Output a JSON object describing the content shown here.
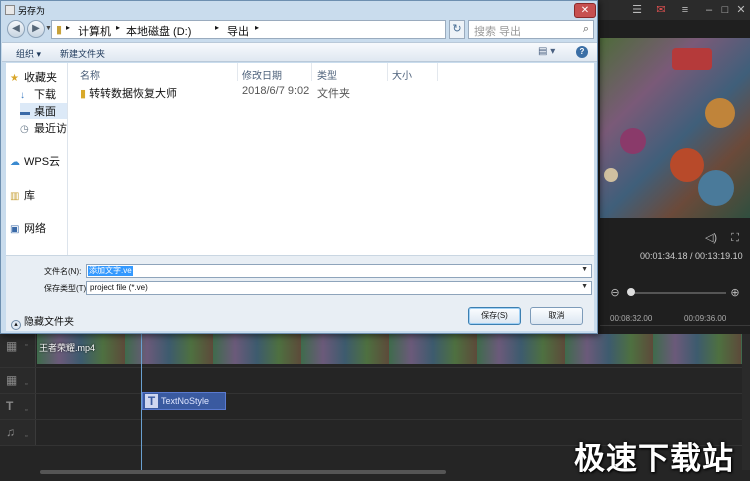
{
  "dialog": {
    "title": "另存为",
    "close_label": "✕",
    "address": {
      "segments": [
        "计算机",
        "本地磁盘 (D:)",
        "导出"
      ]
    },
    "search_placeholder": "搜索 导出",
    "toolbar": {
      "organize": "组织 ▾",
      "new_folder": "新建文件夹",
      "view_icon": "▤ ▾",
      "help": "?"
    },
    "nav_pane": [
      {
        "label": "收藏夹",
        "icon": "star-icon",
        "glyph": "★"
      },
      {
        "label": "下载",
        "icon": "download-icon",
        "glyph": "↓"
      },
      {
        "label": "桌面",
        "icon": "desktop-icon",
        "glyph": "▬"
      },
      {
        "label": "最近访",
        "icon": "recent-icon",
        "glyph": "◷"
      },
      {
        "label": "WPS云",
        "icon": "cloud-icon",
        "glyph": "☁"
      },
      {
        "label": "库",
        "icon": "library-icon",
        "glyph": "▥"
      },
      {
        "label": "网络",
        "icon": "network-icon",
        "glyph": "▣"
      }
    ],
    "columns": {
      "name": "名称",
      "modified": "修改日期",
      "type": "类型",
      "size": "大小"
    },
    "files": [
      {
        "name": "转转数据恢复大师",
        "modified": "2018/6/7 9:02",
        "type": "文件夹",
        "size": ""
      }
    ],
    "filename_label": "文件名(N):",
    "filename_value": "添加文字.ve",
    "filetype_label": "保存类型(T):",
    "filetype_value": "project file (*.ve)",
    "hide_folders": "隐藏文件夹",
    "save_button": "保存(S)",
    "cancel_button": "取消"
  },
  "app": {
    "time_display": "00:01:34.18 / 00:13:19.10",
    "ruler_labels": [
      "00:08:32.00",
      "00:09:36.00"
    ],
    "video_clip_label": "王者荣耀.mp4",
    "text_clip_label": "TextNoStyle",
    "watermark": "极速下载站",
    "accent": "#3a5aa0"
  }
}
